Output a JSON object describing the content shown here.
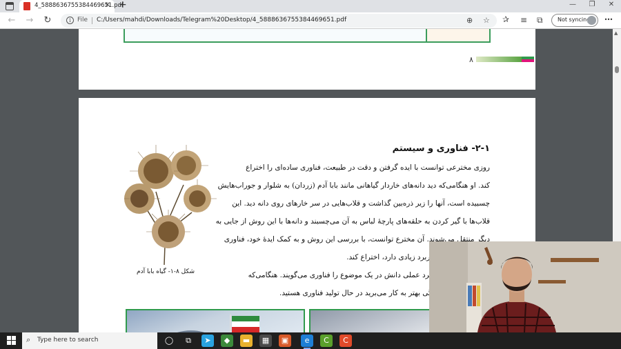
{
  "browser": {
    "tab": {
      "title": "4_5888636755384469651.pdf"
    },
    "address": {
      "scheme_label": "File",
      "url": "C:/Users/mahdi/Downloads/Telegram%20Desktop/4_5888636755384469651.pdf"
    },
    "profile": {
      "label": "Not syncing"
    }
  },
  "pdf": {
    "previous_page": {
      "page_number": "۸"
    },
    "page": {
      "heading": "۲-۱- فناوری و سیستم",
      "paragraph_lines": [
        "روزی مخترعی توانست با ایده گرفتن و دقت در طبیعت، فناوری ساده‌ای را اختراع",
        "کند. او هنگامی‌که دید دانه‌های خاردار گیاهانی مانند بابا آدم (زردان) به شلوار و جوراب‌هایش",
        "چسبیده است، آنها را زیر ذره‌بین گذاشت و قلاب‌هایی در سر خارهای روی دانه دید. این",
        "قلاب‌ها با گیر کردن به حلقه‌های پارچهٔ لباس به آن می‌چسبند و دانه‌ها با این روش از جایی به جای",
        "دیگر منتقل می‌شوند. آن مخترع توانست، با بررسی این روش و به کمک ایدهٔ خود، فناوری",
        "چسبی که امروزه کاربرد زیادی دارد، اختراع کند."
      ],
      "question_lines": [
        "فناوری چیست؟ کاربرد عملی دانش در یک موضوع را فناوری می‌گویند. هنگامی‌که",
        "دانش‌ها را برای زندگی بهتر به کار می‌برید در حال تولید فناوری هستید."
      ],
      "figure_caption": "شکل ۸-۱- گیاه بابا آدم"
    }
  },
  "taskbar": {
    "search_placeholder": "Type here to search"
  },
  "colors": {
    "accent_green": "#3a9c5b",
    "accent_pink": "#e0157a",
    "taskbar": "#1f1f1f"
  }
}
